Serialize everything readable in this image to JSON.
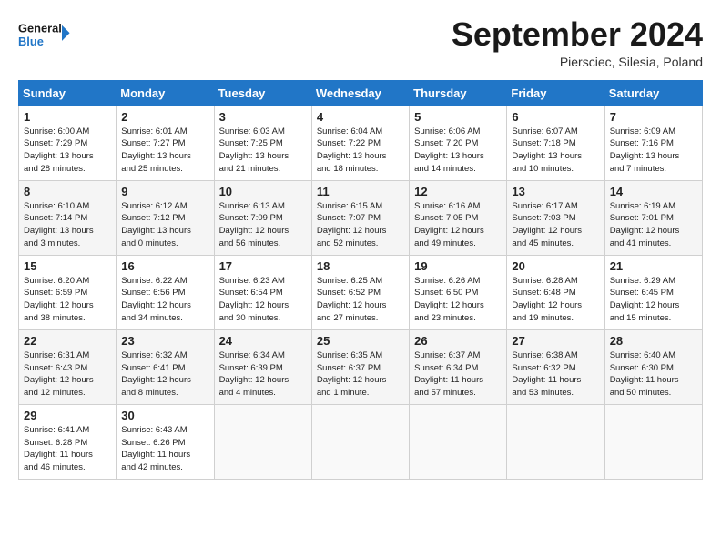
{
  "header": {
    "logo_line1": "General",
    "logo_line2": "Blue",
    "month_title": "September 2024",
    "location": "Piersciec, Silesia, Poland"
  },
  "days_of_week": [
    "Sunday",
    "Monday",
    "Tuesday",
    "Wednesday",
    "Thursday",
    "Friday",
    "Saturday"
  ],
  "weeks": [
    [
      {
        "day": "1",
        "info": "Sunrise: 6:00 AM\nSunset: 7:29 PM\nDaylight: 13 hours\nand 28 minutes."
      },
      {
        "day": "2",
        "info": "Sunrise: 6:01 AM\nSunset: 7:27 PM\nDaylight: 13 hours\nand 25 minutes."
      },
      {
        "day": "3",
        "info": "Sunrise: 6:03 AM\nSunset: 7:25 PM\nDaylight: 13 hours\nand 21 minutes."
      },
      {
        "day": "4",
        "info": "Sunrise: 6:04 AM\nSunset: 7:22 PM\nDaylight: 13 hours\nand 18 minutes."
      },
      {
        "day": "5",
        "info": "Sunrise: 6:06 AM\nSunset: 7:20 PM\nDaylight: 13 hours\nand 14 minutes."
      },
      {
        "day": "6",
        "info": "Sunrise: 6:07 AM\nSunset: 7:18 PM\nDaylight: 13 hours\nand 10 minutes."
      },
      {
        "day": "7",
        "info": "Sunrise: 6:09 AM\nSunset: 7:16 PM\nDaylight: 13 hours\nand 7 minutes."
      }
    ],
    [
      {
        "day": "8",
        "info": "Sunrise: 6:10 AM\nSunset: 7:14 PM\nDaylight: 13 hours\nand 3 minutes."
      },
      {
        "day": "9",
        "info": "Sunrise: 6:12 AM\nSunset: 7:12 PM\nDaylight: 13 hours\nand 0 minutes."
      },
      {
        "day": "10",
        "info": "Sunrise: 6:13 AM\nSunset: 7:09 PM\nDaylight: 12 hours\nand 56 minutes."
      },
      {
        "day": "11",
        "info": "Sunrise: 6:15 AM\nSunset: 7:07 PM\nDaylight: 12 hours\nand 52 minutes."
      },
      {
        "day": "12",
        "info": "Sunrise: 6:16 AM\nSunset: 7:05 PM\nDaylight: 12 hours\nand 49 minutes."
      },
      {
        "day": "13",
        "info": "Sunrise: 6:17 AM\nSunset: 7:03 PM\nDaylight: 12 hours\nand 45 minutes."
      },
      {
        "day": "14",
        "info": "Sunrise: 6:19 AM\nSunset: 7:01 PM\nDaylight: 12 hours\nand 41 minutes."
      }
    ],
    [
      {
        "day": "15",
        "info": "Sunrise: 6:20 AM\nSunset: 6:59 PM\nDaylight: 12 hours\nand 38 minutes."
      },
      {
        "day": "16",
        "info": "Sunrise: 6:22 AM\nSunset: 6:56 PM\nDaylight: 12 hours\nand 34 minutes."
      },
      {
        "day": "17",
        "info": "Sunrise: 6:23 AM\nSunset: 6:54 PM\nDaylight: 12 hours\nand 30 minutes."
      },
      {
        "day": "18",
        "info": "Sunrise: 6:25 AM\nSunset: 6:52 PM\nDaylight: 12 hours\nand 27 minutes."
      },
      {
        "day": "19",
        "info": "Sunrise: 6:26 AM\nSunset: 6:50 PM\nDaylight: 12 hours\nand 23 minutes."
      },
      {
        "day": "20",
        "info": "Sunrise: 6:28 AM\nSunset: 6:48 PM\nDaylight: 12 hours\nand 19 minutes."
      },
      {
        "day": "21",
        "info": "Sunrise: 6:29 AM\nSunset: 6:45 PM\nDaylight: 12 hours\nand 15 minutes."
      }
    ],
    [
      {
        "day": "22",
        "info": "Sunrise: 6:31 AM\nSunset: 6:43 PM\nDaylight: 12 hours\nand 12 minutes."
      },
      {
        "day": "23",
        "info": "Sunrise: 6:32 AM\nSunset: 6:41 PM\nDaylight: 12 hours\nand 8 minutes."
      },
      {
        "day": "24",
        "info": "Sunrise: 6:34 AM\nSunset: 6:39 PM\nDaylight: 12 hours\nand 4 minutes."
      },
      {
        "day": "25",
        "info": "Sunrise: 6:35 AM\nSunset: 6:37 PM\nDaylight: 12 hours\nand 1 minute."
      },
      {
        "day": "26",
        "info": "Sunrise: 6:37 AM\nSunset: 6:34 PM\nDaylight: 11 hours\nand 57 minutes."
      },
      {
        "day": "27",
        "info": "Sunrise: 6:38 AM\nSunset: 6:32 PM\nDaylight: 11 hours\nand 53 minutes."
      },
      {
        "day": "28",
        "info": "Sunrise: 6:40 AM\nSunset: 6:30 PM\nDaylight: 11 hours\nand 50 minutes."
      }
    ],
    [
      {
        "day": "29",
        "info": "Sunrise: 6:41 AM\nSunset: 6:28 PM\nDaylight: 11 hours\nand 46 minutes."
      },
      {
        "day": "30",
        "info": "Sunrise: 6:43 AM\nSunset: 6:26 PM\nDaylight: 11 hours\nand 42 minutes."
      },
      {
        "day": "",
        "info": ""
      },
      {
        "day": "",
        "info": ""
      },
      {
        "day": "",
        "info": ""
      },
      {
        "day": "",
        "info": ""
      },
      {
        "day": "",
        "info": ""
      }
    ]
  ]
}
